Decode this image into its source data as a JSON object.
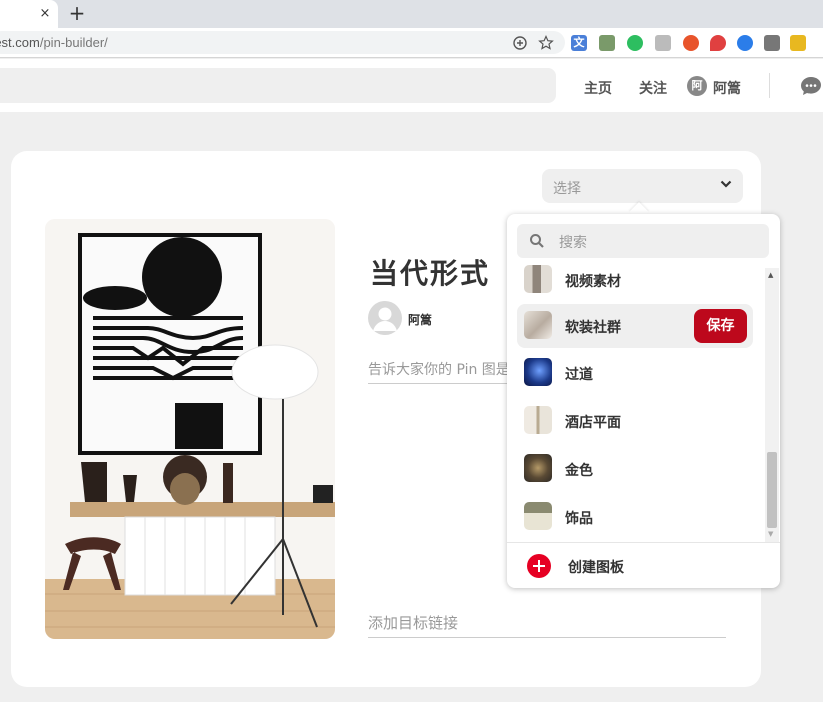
{
  "browser": {
    "tab_close": "×",
    "new_tab": "+",
    "url_host": "rest.com",
    "url_path": "/pin-builder/"
  },
  "nav": {
    "home": "主页",
    "following": "关注",
    "avatar_letter": "阿",
    "username": "阿篙"
  },
  "builder": {
    "board_select_placeholder": "选择",
    "pin_title": "当代形式",
    "author_name": "阿篙",
    "description_placeholder": "告诉大家你的 Pin 图是",
    "link_placeholder": "添加目标链接"
  },
  "dropdown": {
    "search_placeholder": "搜索",
    "boards": [
      {
        "name": "视频素材",
        "thumb_color": "#b9b2aa"
      },
      {
        "name": "软装社群",
        "thumb_color": "#cfc6bd",
        "hovered": true
      },
      {
        "name": "过道",
        "thumb_color": "#1c3a8a"
      },
      {
        "name": "酒店平面",
        "thumb_color": "#d8d2c5"
      },
      {
        "name": "金色",
        "thumb_color": "#6b5a3f"
      },
      {
        "name": "饰品",
        "thumb_color": "#c9c7b4"
      }
    ],
    "save_label": "保存",
    "create_board_label": "创建图板"
  },
  "colors": {
    "brand_red": "#e60023",
    "save_red": "#bd081c"
  }
}
